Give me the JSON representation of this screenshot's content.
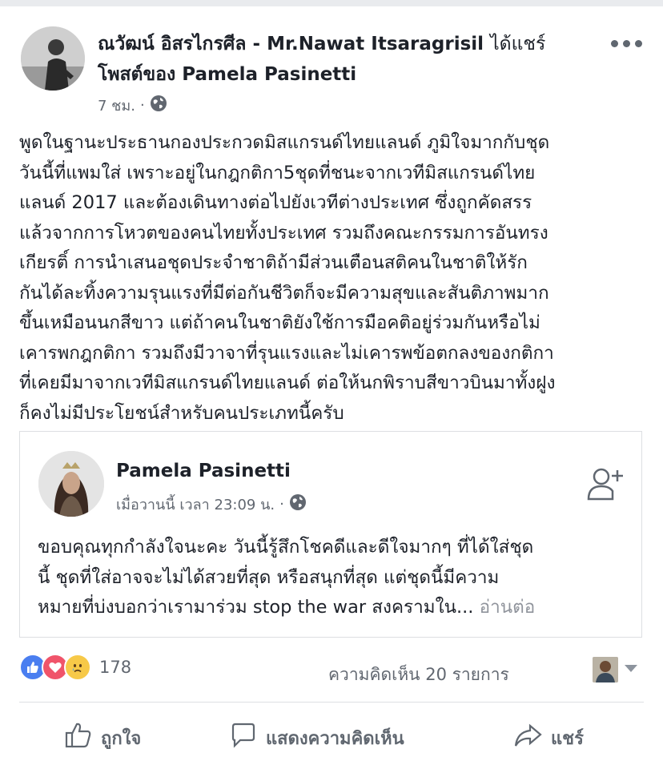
{
  "post": {
    "author": "ณวัฒน์ อิสรไกรศีล - Mr.Nawat Itsaragrisil",
    "shared_text": "ได้แชร์",
    "shared_line2": "โพสต์ของ Pamela Pasinetti",
    "time": "7 ชม.",
    "separator": "·",
    "privacy_icon": "globe-icon",
    "text": "พูดในฐานะประธานกองประกวดมิสแกรนด์ไทยแลนด์ ภูมิใจมากกับชุด\nวันนี้ที่แพมใส่ เพราะอยู่ในกฎกติกา5ชุดที่ชนะจากเวทีมิสแกรนด์ไทย\nแลนด์ 2017 และต้องเดินทางต่อไปยังเวทีต่างประเทศ ซึ่งถูกคัดสรร\nแล้วจากการโหวตของคนไทยทั้งประเทศ รวมถึงคณะกรรมการอันทรง\nเกียรติ์ การนำเสนอชุดประจำชาติถ้ามีส่วนเตือนสติคนในชาติให้รัก\nกันได้ละทิ้งความรุนแรงที่มีต่อกันชีวิตก็จะมีความสุขและสันติภาพมาก\nขึ้นเหมือนนกสีขาว แต่ถ้าคนในชาติยังใช้การมือคติอยู่ร่วมกันหรือไม่\nเคารพกฎกติกา รวมถึงมีวาจาที่รุนแรงและไม่เคารพข้อตกลงของกติกา\nที่เคยมีมาจากเวทีมิสแกรนด์ไทยแลนด์ ต่อให้นกพิราบสีขาวบินมาทั้งฝูง\nก็คงไม่มีประโยชน์สำหรับคนประเภทนี้ครับ"
  },
  "shared_post": {
    "author": "Pamela Pasinetti",
    "time": "เมื่อวานนี้ เวลา 23:09 น.",
    "separator": "·",
    "text": "ขอบคุณทุกกำลังใจนะคะ วันนี้รู้สึกโชคดีและดีใจมากๆ ที่ได้ใส่ชุด\nนี้ ชุดที่ใส่อาจจะไม่ได้สวยที่สุด หรือสนุกที่สุด แต่ชุดนี้มีความ\nหมายที่บ่งบอกว่าเรามาร่วม stop the war สงครามใน... ",
    "see_more": "อ่านต่อ"
  },
  "reactions": {
    "icons": [
      "like-icon",
      "love-icon",
      "sad-icon"
    ],
    "count": "178",
    "comments": "ความคิดเห็น 20 รายการ"
  },
  "actions": {
    "like": "ถูกใจ",
    "comment": "แสดงความคิดเห็น",
    "share": "แชร์"
  },
  "colors": {
    "like": "#4a7ef0",
    "love": "#f0546a",
    "sad": "#f7c948",
    "secondary_text": "#616770"
  }
}
